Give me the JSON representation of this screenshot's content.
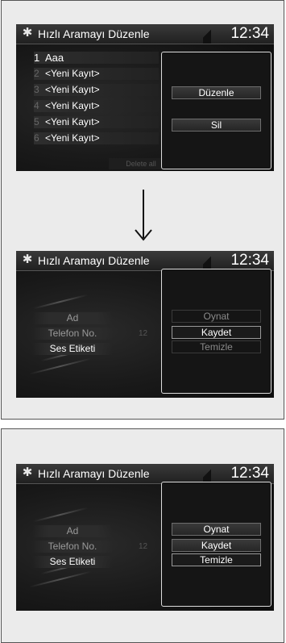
{
  "screen1": {
    "title": "Hızlı Aramayı Düzenle",
    "clock": "12:34",
    "list": [
      {
        "num": "1",
        "label": "Aaa"
      },
      {
        "num": "2",
        "label": "<Yeni Kayıt>"
      },
      {
        "num": "3",
        "label": "<Yeni Kayıt>"
      },
      {
        "num": "4",
        "label": "<Yeni Kayıt>"
      },
      {
        "num": "5",
        "label": "<Yeni Kayıt>"
      },
      {
        "num": "6",
        "label": "<Yeni Kayıt>"
      }
    ],
    "faint_button": "Delete all",
    "popup": {
      "edit": "Düzenle",
      "delete": "Sil"
    }
  },
  "screen2": {
    "title": "Hızlı Aramayı Düzenle",
    "clock": "12:34",
    "fields": {
      "name": "Ad",
      "phone": "Telefon No.",
      "voice_tag": "Ses Etiketi"
    },
    "faint_num": "12",
    "faint_ok": "OK",
    "popup": {
      "play": "Oynat",
      "save": "Kaydet",
      "clear": "Temizle"
    }
  },
  "screen3": {
    "title": "Hızlı Aramayı Düzenle",
    "clock": "12:34",
    "fields": {
      "name": "Ad",
      "phone": "Telefon No.",
      "voice_tag": "Ses Etiketi"
    },
    "faint_num": "12",
    "faint_ok": "OK",
    "popup": {
      "play": "Oynat",
      "save": "Kaydet",
      "clear": "Temizle"
    }
  },
  "arrow_icon": "arrow-down-icon",
  "gear_icon": "gear-icon"
}
